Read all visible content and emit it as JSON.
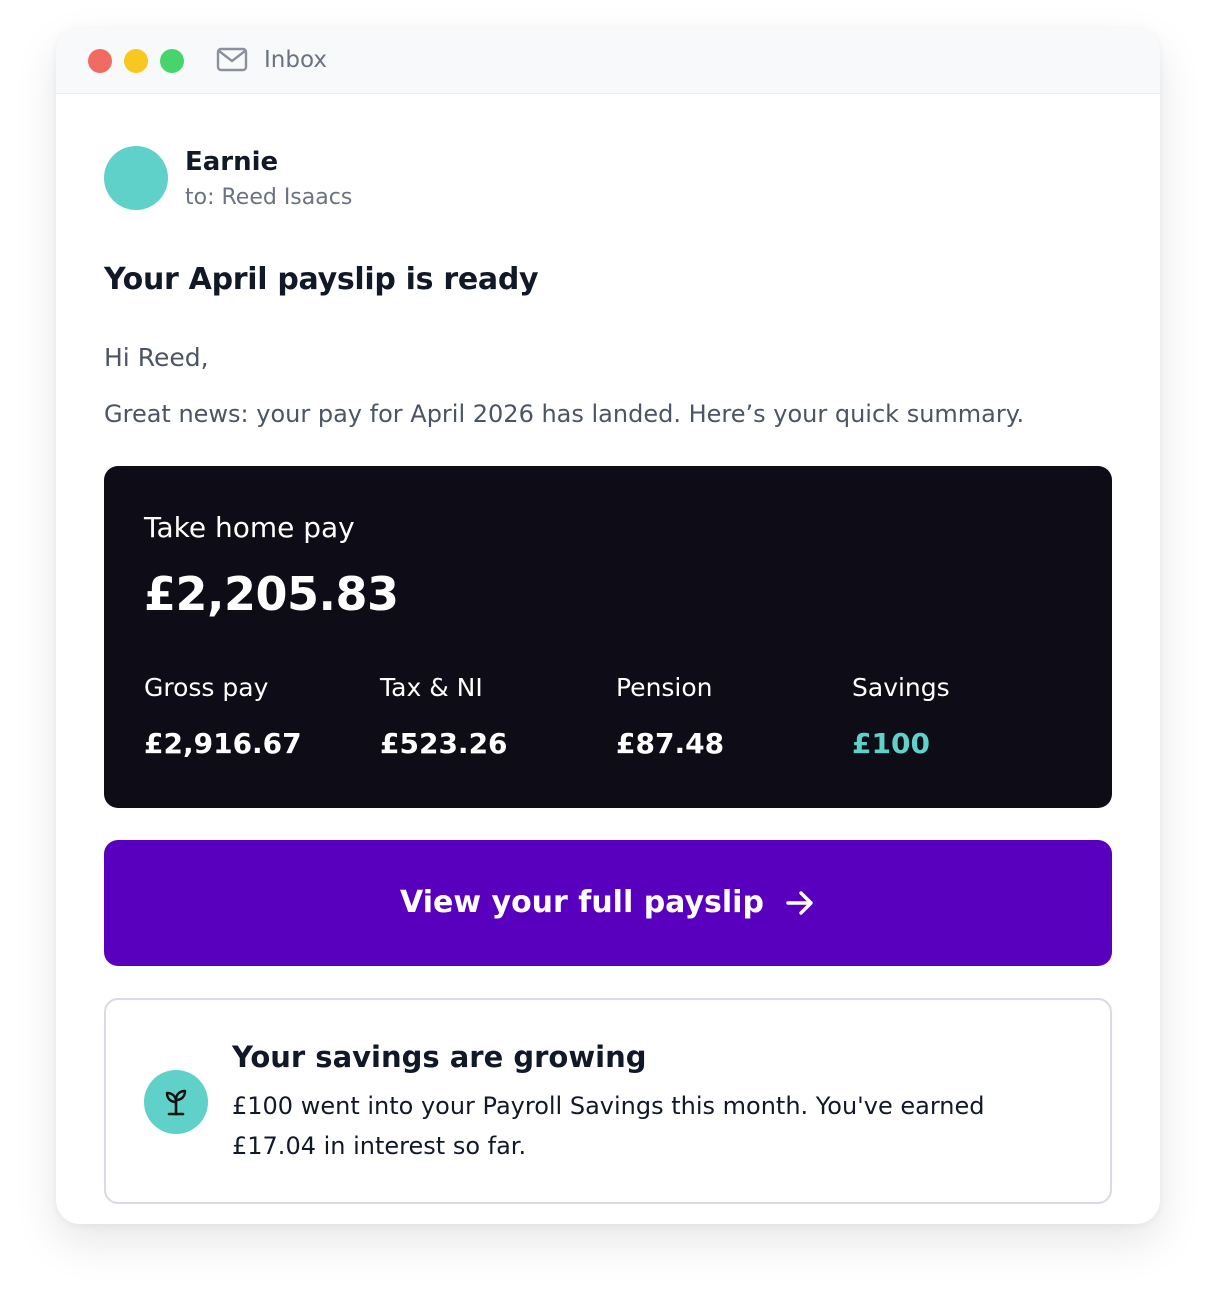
{
  "window": {
    "title": "Inbox",
    "icon": "mail-icon",
    "controls": {
      "close_color": "#f16b63",
      "minimize_color": "#f9c81e",
      "maximize_color": "#47d46a"
    }
  },
  "email": {
    "sender": "Earnie",
    "recipient": "to: Reed Isaacs",
    "avatar_color": "#5fd1c9",
    "subject": "Your April payslip is ready",
    "greeting": "Hi Reed,",
    "intro": "Great news: your pay for April 2026 has landed. Here’s your quick summary."
  },
  "summary": {
    "background": "#0e0c17",
    "take_home_label": "Take home pay",
    "take_home_value": "£2,205.83",
    "stats": [
      {
        "label": "Gross pay",
        "value": "£2,916.67"
      },
      {
        "label": "Tax & NI",
        "value": "£523.26"
      },
      {
        "label": "Pension",
        "value": "£87.48"
      },
      {
        "label": "Savings",
        "value": "£100",
        "accent": "#5fd1c9"
      }
    ]
  },
  "cta": {
    "label": "View your full payslip",
    "icon": "arrow-right-icon",
    "color": "#5800be"
  },
  "savings_card": {
    "icon": "sprout-icon",
    "icon_bg": "#5fd1c9",
    "title": "Your savings are growing",
    "body": "£100 went into your Payroll Savings this month. You've earned £17.04 in interest so far."
  }
}
